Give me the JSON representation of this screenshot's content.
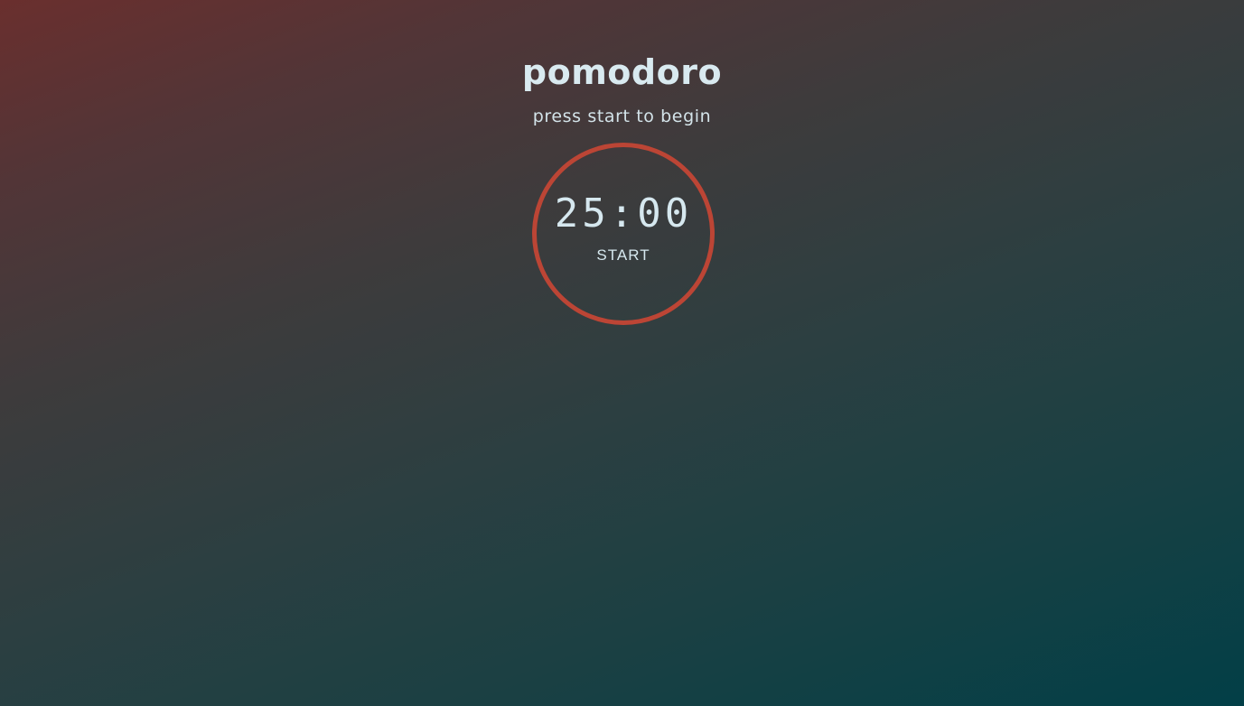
{
  "app": {
    "title": "pomodoro",
    "subtitle": "press start to begin"
  },
  "timer": {
    "time": "25:00",
    "action_label": "START",
    "ring_color": "#bc4535"
  },
  "colors": {
    "background_top_left": "#6a2f2e",
    "background_bottom_right": "#023f47",
    "text": "#d7e8ee"
  }
}
